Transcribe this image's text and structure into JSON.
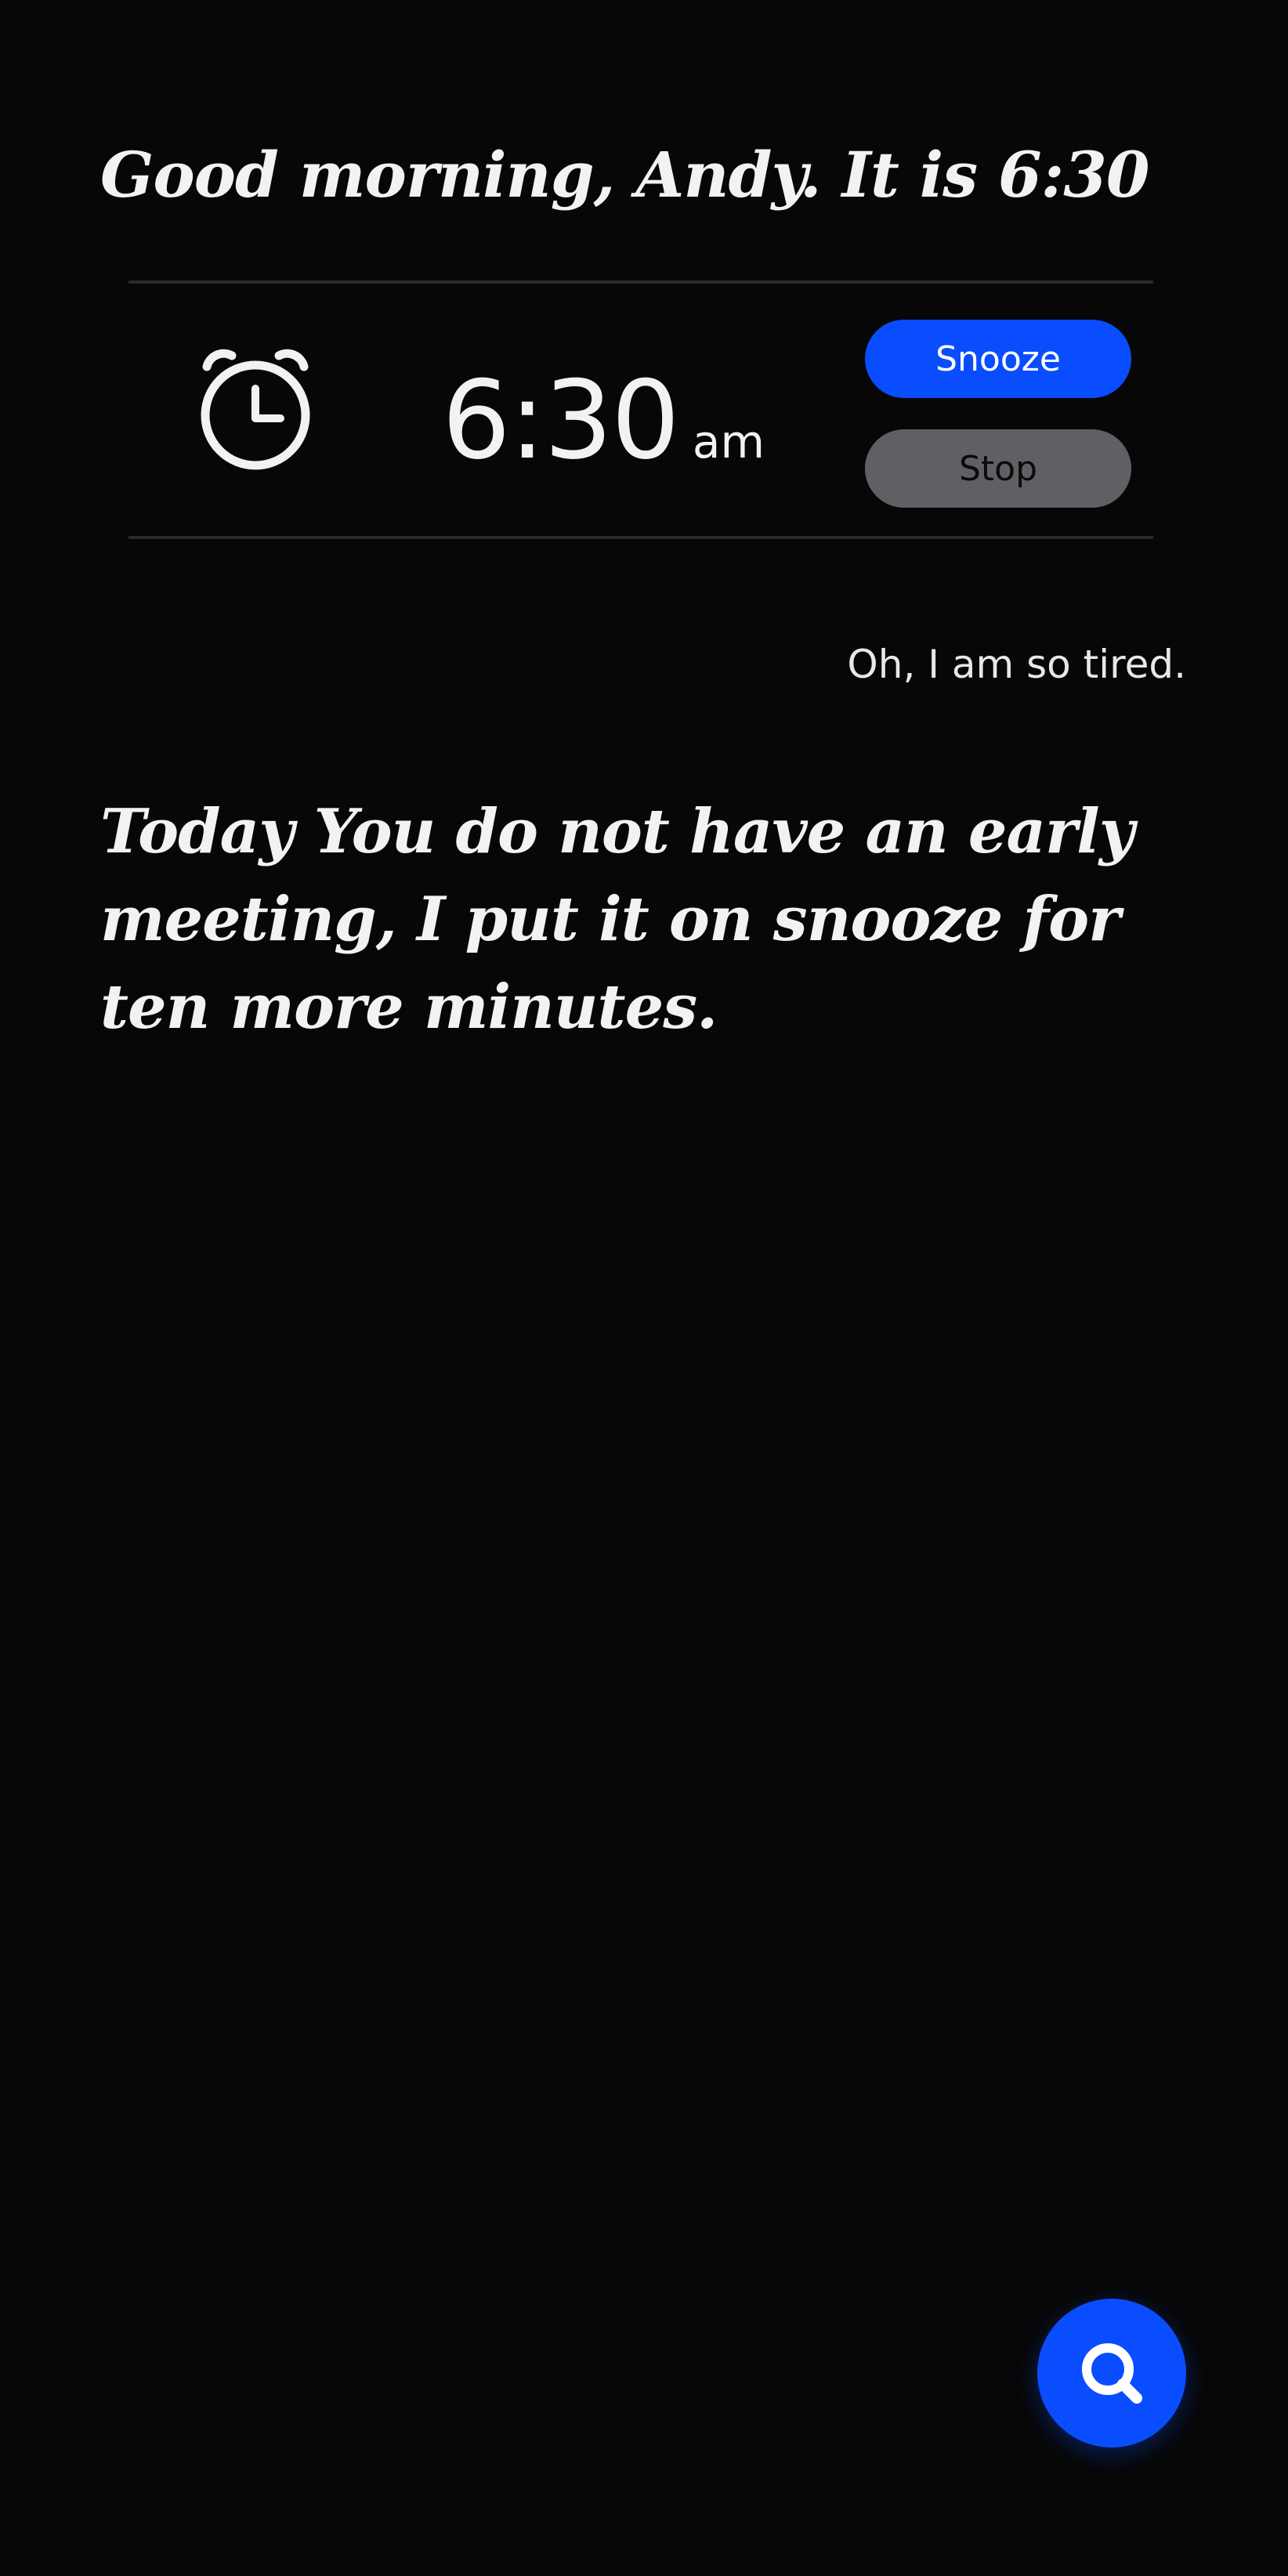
{
  "greeting": "Good morning, Andy. It is 6:30",
  "alarm": {
    "icon": "alarm-clock-icon",
    "time": "6:30",
    "period": "am",
    "snooze_label": "Snooze",
    "stop_label": "Stop"
  },
  "conversation": {
    "user_message": "Oh, I am so tired.",
    "assistant_message": "Today You do not have an early meeting, I put it on snooze for ten more minutes."
  },
  "fab": {
    "icon": "search-icon"
  },
  "colors": {
    "background": "#070707",
    "accent": "#0a4dff",
    "stop_button": "#5e6064",
    "text": "#f2f2f2"
  }
}
